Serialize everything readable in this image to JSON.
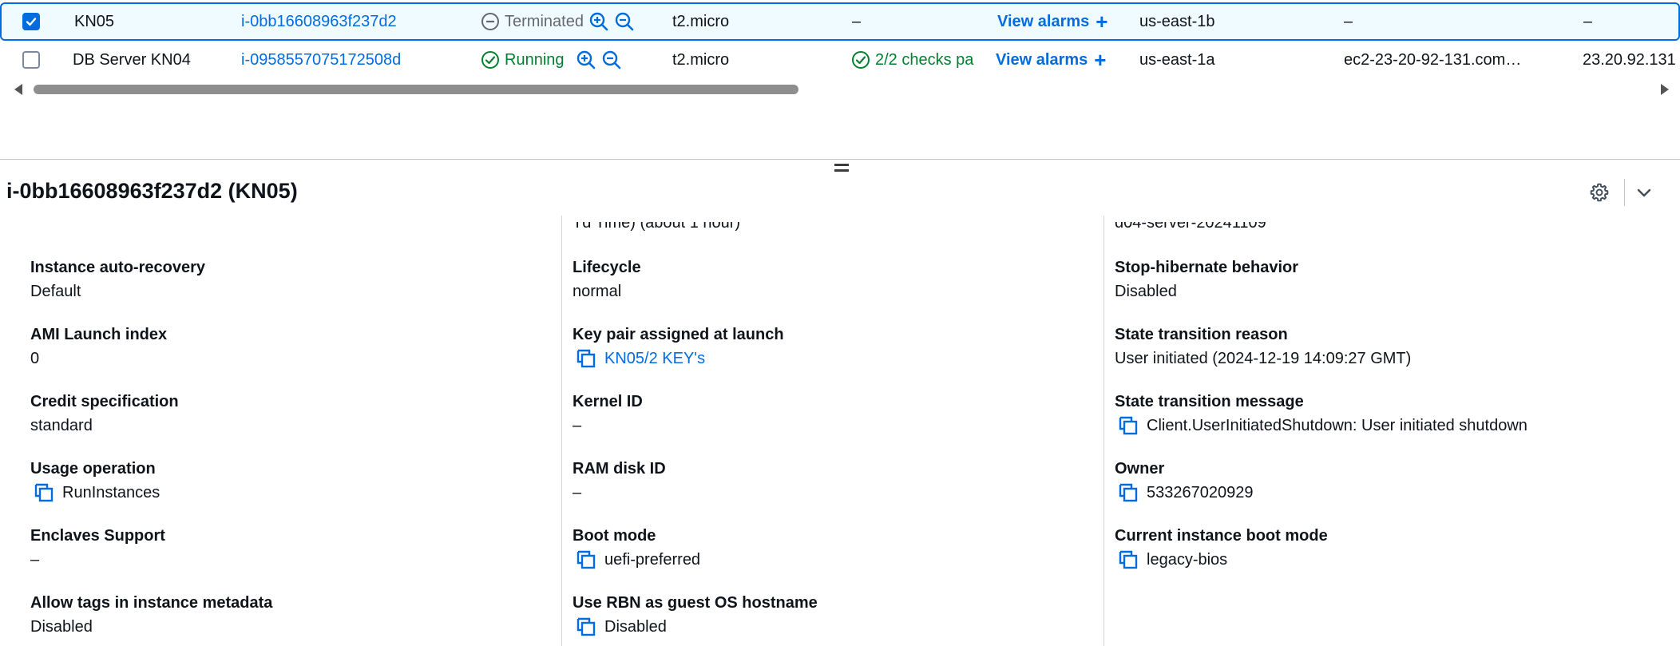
{
  "table": {
    "rows": [
      {
        "name": "KN05",
        "instance_id": "i-0bb16608963f237d2",
        "state": "Terminated",
        "type": "t2.micro",
        "checks": "–",
        "alarms": "View alarms",
        "az": "us-east-1b",
        "dns": "–",
        "ip": "–",
        "selected": true
      },
      {
        "name": "DB Server KN04",
        "instance_id": "i-0958557075172508d",
        "state": "Running",
        "type": "t2.micro",
        "checks": "2/2 checks pa",
        "alarms": "View alarms",
        "az": "us-east-1a",
        "dns": "ec2-23-20-92-131.com…",
        "ip": "23.20.92.131",
        "selected": false
      }
    ]
  },
  "details": {
    "title": "i-0bb16608963f237d2 (KN05)",
    "cut_texts": {
      "col2": "Td Time) (about 1 hour)",
      "col3": "d04-server-20241109"
    },
    "col1": [
      {
        "label": "Instance auto-recovery",
        "value": "Default"
      },
      {
        "label": "AMI Launch index",
        "value": "0"
      },
      {
        "label": "Credit specification",
        "value": "standard"
      },
      {
        "label": "Usage operation",
        "value": "RunInstances"
      },
      {
        "label": "Enclaves Support",
        "value": "–"
      },
      {
        "label": "Allow tags in instance metadata",
        "value": "Disabled"
      }
    ],
    "col2": [
      {
        "label": "Lifecycle",
        "value": "normal"
      },
      {
        "label": "Key pair assigned at launch",
        "value": "KN05/2 KEY's"
      },
      {
        "label": "Kernel ID",
        "value": "–"
      },
      {
        "label": "RAM disk ID",
        "value": "–"
      },
      {
        "label": "Boot mode",
        "value": "uefi-preferred"
      },
      {
        "label": "Use RBN as guest OS hostname",
        "value": "Disabled"
      }
    ],
    "col3": [
      {
        "label": "Stop-hibernate behavior",
        "value": "Disabled"
      },
      {
        "label": "State transition reason",
        "value": "User initiated (2024-12-19 14:09:27 GMT)"
      },
      {
        "label": "State transition message",
        "value": "Client.UserInitiatedShutdown: User initiated shutdown"
      },
      {
        "label": "Owner",
        "value": "533267020929"
      },
      {
        "label": "Current instance boot mode",
        "value": "legacy-bios"
      }
    ]
  },
  "colors": {
    "link": "#006ce0",
    "running": "#00802f",
    "terminated": "#656871",
    "selected_border": "#006ce0"
  }
}
